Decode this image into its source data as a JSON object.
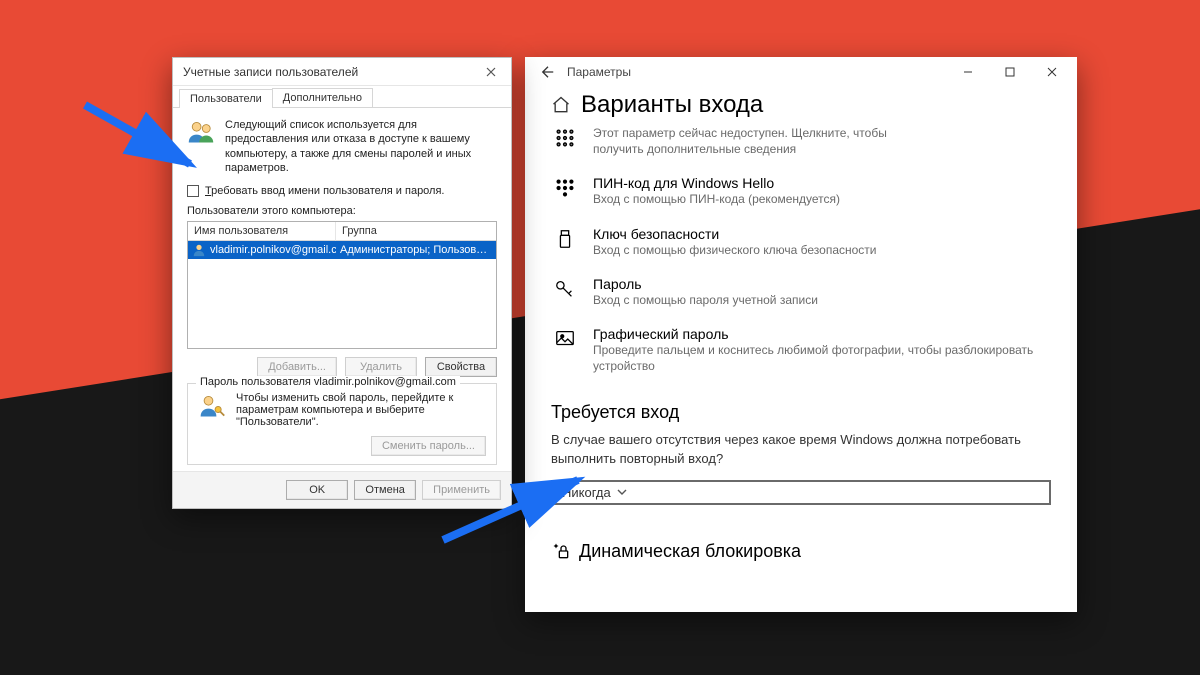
{
  "settings": {
    "app_title": "Параметры",
    "page_title": "Варианты входа",
    "truncated": {
      "title_tail": "Этот параметр сейчас недоступен. Щелкните, чтобы",
      "sub": "получить дополнительные сведения"
    },
    "options": [
      {
        "title": "ПИН-код для Windows Hello",
        "sub": "Вход с помощью ПИН-кода (рекомендуется)"
      },
      {
        "title": "Ключ безопасности",
        "sub": "Вход с помощью физического ключа безопасности"
      },
      {
        "title": "Пароль",
        "sub": "Вход с помощью пароля учетной записи"
      },
      {
        "title": "Графический пароль",
        "sub": "Проведите пальцем и коснитесь любимой фотографии, чтобы разблокировать устройство"
      }
    ],
    "signin_required": {
      "heading": "Требуется вход",
      "desc": "В случае вашего отсутствия через какое время Windows должна потребовать выполнить повторный вход?",
      "value": "Никогда"
    },
    "dynamic_lock": "Динамическая блокировка"
  },
  "netplwiz": {
    "title": "Учетные записи пользователей",
    "tab_users": "Пользователи",
    "tab_advanced": "Дополнительно",
    "intro": "Следующий список используется для предоставления или отказа в доступе к вашему компьютеру, а также для смены паролей и иных параметров.",
    "checkbox": {
      "pre": "Т",
      "rest": "ребовать ввод имени пользователя и пароля."
    },
    "list_label": "Пользователи этого компьютера:",
    "col_user": "Имя пользователя",
    "col_group": "Группа",
    "row_user": "vladimir.polnikov@gmail.com",
    "row_group": "Администраторы; Пользоват...",
    "btn_add": "Добавить...",
    "btn_remove": "Удалить",
    "btn_props": "Свойства",
    "pw_legend": "Пароль пользователя vladimir.polnikov@gmail.com",
    "pw_text": "Чтобы изменить свой пароль, перейдите к параметрам компьютера и выберите \"Пользователи\".",
    "btn_change_pw": "Сменить пароль...",
    "btn_ok": "OK",
    "btn_cancel": "Отмена",
    "btn_apply": "Применить"
  }
}
